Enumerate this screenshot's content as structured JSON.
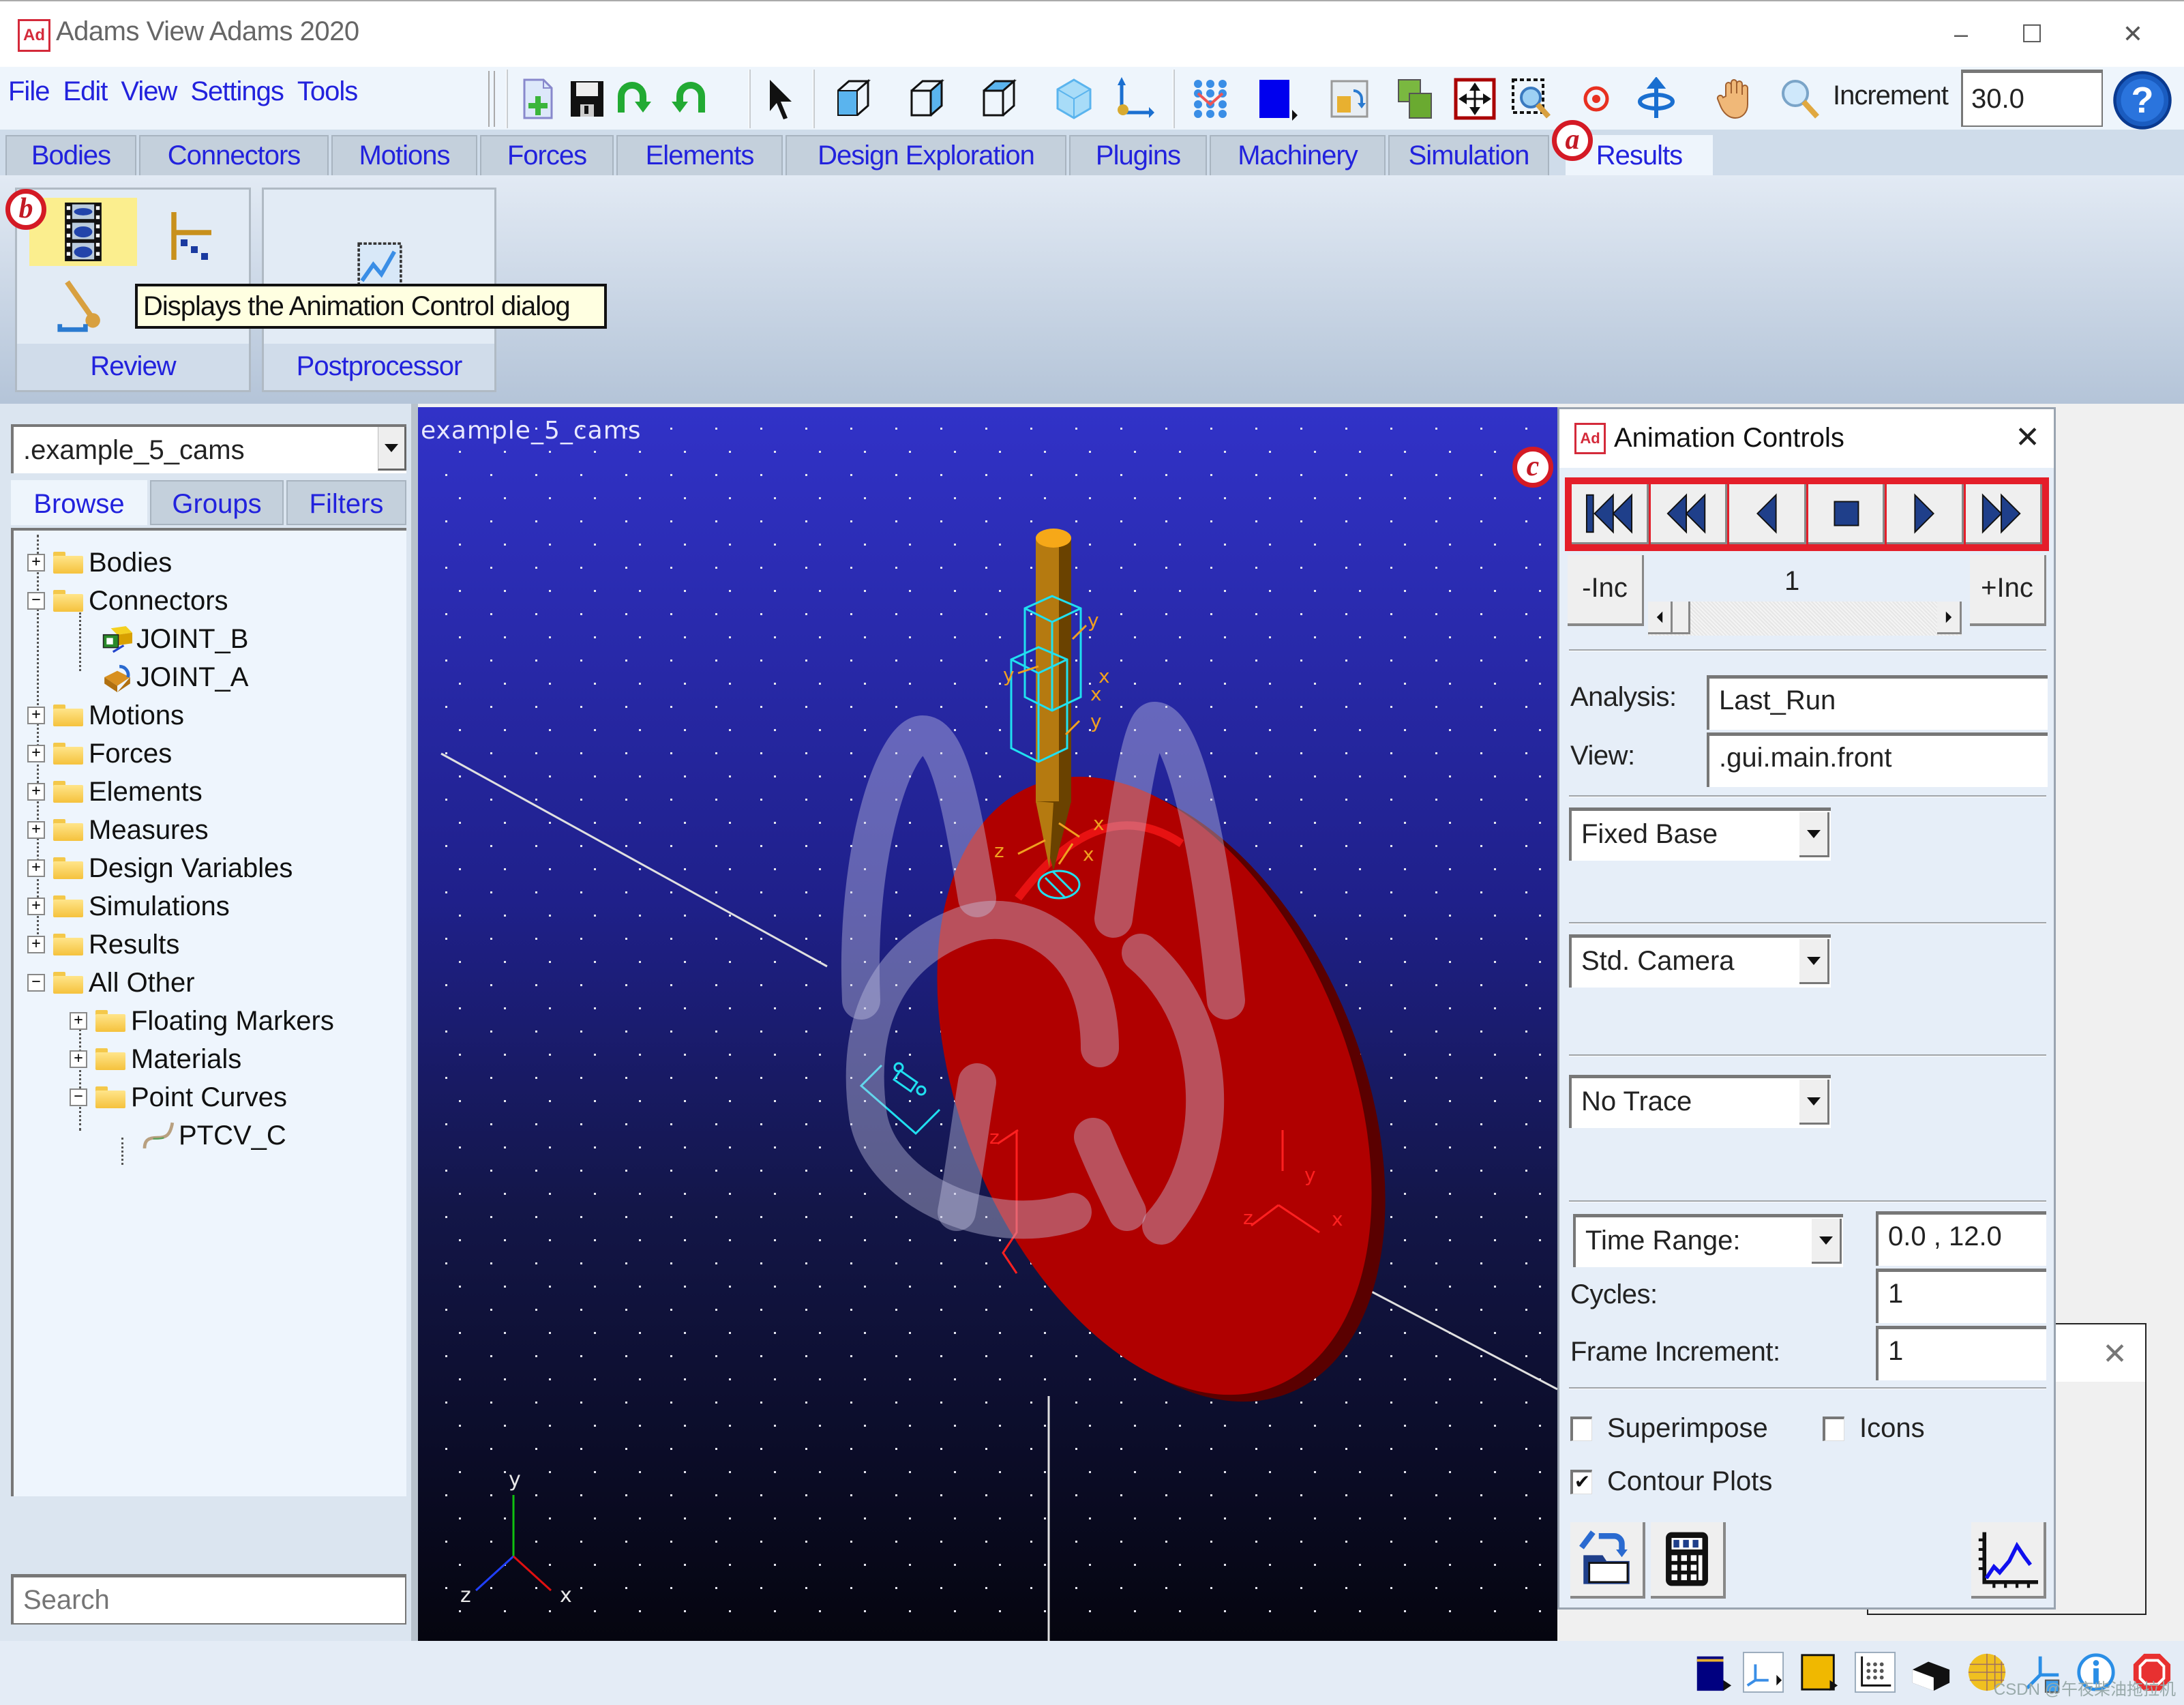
{
  "window": {
    "app_icon": "Ad",
    "title": "Adams View Adams 2020",
    "controls": {
      "minimize": "–",
      "maximize": "☐",
      "close": "✕"
    }
  },
  "menu": [
    "File",
    "Edit",
    "View",
    "Settings",
    "Tools"
  ],
  "toolbar": {
    "icons": [
      "new-model-icon",
      "save-icon",
      "undo-icon",
      "redo-icon",
      "select-pointer-icon",
      "view-front-icon",
      "view-side-icon",
      "view-top-icon",
      "render-mode-icon",
      "working-grid-icon",
      "marker-icons-toggle-icon",
      "background-color-icon",
      "view-layout-icon",
      "group-icon",
      "fit-view-icon",
      "zoom-box-icon",
      "center-icon",
      "rotate-icon",
      "pan-hand-icon",
      "zoom-icon"
    ],
    "increment_label": "Increment",
    "increment_value": "30.0",
    "help_icon": "help-icon"
  },
  "tabs": [
    {
      "label": "Bodies"
    },
    {
      "label": "Connectors"
    },
    {
      "label": "Motions"
    },
    {
      "label": "Forces"
    },
    {
      "label": "Elements"
    },
    {
      "label": "Design Exploration"
    },
    {
      "label": "Plugins"
    },
    {
      "label": "Machinery"
    },
    {
      "label": "Simulation"
    },
    {
      "label": "Results",
      "active": true
    }
  ],
  "ribbon": {
    "groups": [
      {
        "label": "Review",
        "buttons": [
          "animation-controls-icon",
          "create-trace-spline-icon",
          "measure-icon"
        ]
      },
      {
        "label": "Postprocessor",
        "buttons": [
          "postprocessor-icon"
        ]
      }
    ],
    "tooltip": "Displays the Animation Control dialog"
  },
  "annotations": {
    "a": "a",
    "b": "b",
    "c": "c"
  },
  "left_panel": {
    "model_select": ".example_5_cams",
    "tabs": [
      {
        "label": "Browse",
        "active": true
      },
      {
        "label": "Groups"
      },
      {
        "label": "Filters"
      }
    ],
    "tree": [
      {
        "label": "Bodies",
        "level": 0,
        "expander": "+",
        "icon": "folder"
      },
      {
        "label": "Connectors",
        "level": 0,
        "expander": "−",
        "icon": "folder-open"
      },
      {
        "label": "JOINT_B",
        "level": 1,
        "icon": "translational-joint"
      },
      {
        "label": "JOINT_A",
        "level": 1,
        "icon": "revolute-joint"
      },
      {
        "label": "Motions",
        "level": 0,
        "expander": "+",
        "icon": "folder"
      },
      {
        "label": "Forces",
        "level": 0,
        "expander": "+",
        "icon": "folder"
      },
      {
        "label": "Elements",
        "level": 0,
        "expander": "+",
        "icon": "folder"
      },
      {
        "label": "Measures",
        "level": 0,
        "expander": "+",
        "icon": "folder"
      },
      {
        "label": "Design Variables",
        "level": 0,
        "expander": "+",
        "icon": "folder"
      },
      {
        "label": "Simulations",
        "level": 0,
        "expander": "+",
        "icon": "folder"
      },
      {
        "label": "Results",
        "level": 0,
        "expander": "+",
        "icon": "folder"
      },
      {
        "label": "All Other",
        "level": 0,
        "expander": "−",
        "icon": "folder-open"
      },
      {
        "label": "Floating Markers",
        "level": 1,
        "expander": "+",
        "icon": "folder"
      },
      {
        "label": "Materials",
        "level": 1,
        "expander": "+",
        "icon": "folder"
      },
      {
        "label": "Point Curves",
        "level": 1,
        "expander": "−",
        "icon": "folder-open"
      },
      {
        "label": "PTCV_C",
        "level": 2,
        "icon": "curve"
      }
    ],
    "search_placeholder": "Search"
  },
  "viewport": {
    "model_label": "example_5_cams",
    "triad": {
      "x": "x",
      "y": "y",
      "z": "z"
    },
    "marker_labels": [
      "y",
      "x",
      "y",
      "x",
      "y",
      "x",
      "z",
      "x",
      "y",
      "z",
      "y",
      "z",
      "x"
    ],
    "colors": {
      "cam": "#b00000",
      "follower": "#c88a10",
      "joint_wire": "#20e0f0",
      "background_top": "#3132c8",
      "background_bottom": "#05050f"
    }
  },
  "animation_dialog": {
    "icon": "Ad",
    "title": "Animation Controls",
    "close": "✕",
    "playback_buttons": [
      "rewind-to-start",
      "play-backward-fast",
      "play-backward",
      "stop",
      "play-forward",
      "play-forward-fast"
    ],
    "minus_inc": "-Inc",
    "plus_inc": "+Inc",
    "frame": "1",
    "analysis_label": "Analysis:",
    "analysis_value": "Last_Run",
    "view_label": "View:",
    "view_value": ".gui.main.front",
    "base_select": "Fixed Base",
    "camera_select": "Std. Camera",
    "trace_select": "No Trace",
    "range_select": "Time Range:",
    "range_value": "0.0 , 12.0",
    "cycles_label": "Cycles:",
    "cycles_value": "1",
    "frame_inc_label": "Frame Increment:",
    "frame_inc_value": "1",
    "superimpose_label": "Superimpose",
    "superimpose_checked": false,
    "icons_label": "Icons",
    "icons_checked": false,
    "contour_label": "Contour Plots",
    "contour_checked": true,
    "check_mark": "✔",
    "bottom_buttons": [
      "save-animation-icon",
      "calculator-icon",
      "plot-icon"
    ]
  },
  "back_dialog": {
    "close": "✕"
  },
  "statusbar": {
    "icons": [
      "background-color-icon",
      "triad-icon",
      "color-icon",
      "grid-icon",
      "render-icon",
      "shading-sphere-icon",
      "coordinate-system-icon",
      "info-icon",
      "stop-icon"
    ],
    "watermark": "CSDN @午夜柴油拖拉机"
  }
}
